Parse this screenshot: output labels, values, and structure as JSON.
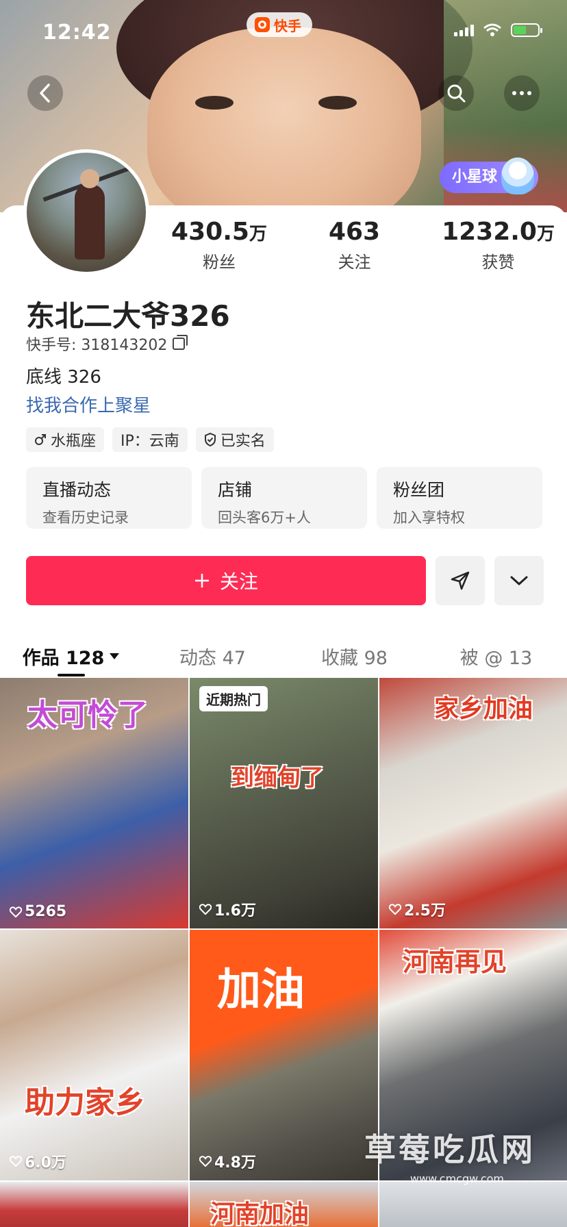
{
  "status_bar": {
    "time": "12:42",
    "app_name": "快手"
  },
  "header": {
    "back_icon": "chevron-left-icon",
    "search_icon": "search-icon",
    "more_icon": "more-icon",
    "star_pill": "小星球"
  },
  "profile": {
    "stats": [
      {
        "num": "430.5",
        "unit": "万",
        "label": "粉丝"
      },
      {
        "num": "463",
        "unit": "",
        "label": "关注"
      },
      {
        "num": "1232.0",
        "unit": "万",
        "label": "获赞"
      }
    ],
    "name": "东北二大爷326",
    "kuaishou_id": "快手号: 318143202",
    "bio": "底线 326",
    "link": "找我合作上聚星",
    "tags": [
      "水瓶座",
      "IP：云南",
      "已实名"
    ]
  },
  "cards": [
    {
      "title": "直播动态",
      "sub": "查看历史记录"
    },
    {
      "title": "店铺",
      "sub": "回头客6万+人"
    },
    {
      "title": "粉丝团",
      "sub": "加入享特权"
    }
  ],
  "actions": {
    "follow_label": "关注"
  },
  "tabs": [
    {
      "label": "作品 128",
      "active": true
    },
    {
      "label": "动态 47",
      "active": false
    },
    {
      "label": "收藏 98",
      "active": false
    },
    {
      "label": "被 @ 13",
      "active": false
    }
  ],
  "videos": [
    {
      "overlay": "太可怜了",
      "likes": "5265"
    },
    {
      "badge": "近期热门",
      "overlay": "到缅甸了",
      "likes": "1.6万"
    },
    {
      "overlay": "家乡加油",
      "likes": "2.5万"
    },
    {
      "overlay": "助力家乡",
      "likes": "6.0万"
    },
    {
      "overlay": "加油",
      "likes": "4.8万"
    },
    {
      "overlay": "河南再见",
      "likes": ""
    },
    {
      "overlay": "",
      "likes": ""
    },
    {
      "overlay": "河南加油",
      "likes": ""
    },
    {
      "overlay": "",
      "likes": ""
    }
  ],
  "watermark": {
    "text": "草莓吃瓜网",
    "url": "www.cmcgw.com"
  },
  "colors": {
    "accent": "#fe2c55",
    "link": "#3b69b0",
    "kuaishou_orange": "#ff4a00"
  }
}
